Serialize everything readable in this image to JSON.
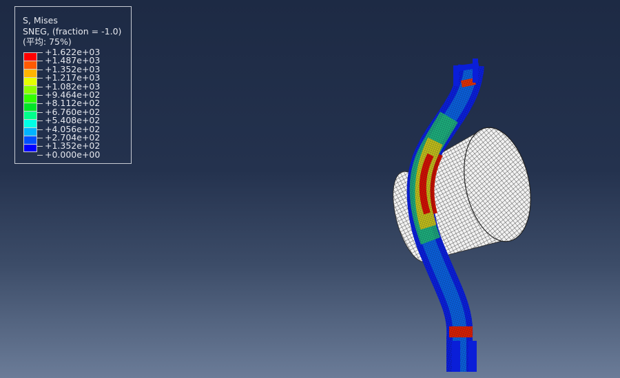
{
  "legend": {
    "title": "S, Mises",
    "subtitle": "SNEG, (fraction = -1.0)",
    "averaging": "(平均: 75%)",
    "labels": [
      "+1.622e+03",
      "+1.487e+03",
      "+1.352e+03",
      "+1.217e+03",
      "+1.082e+03",
      "+9.464e+02",
      "+8.112e+02",
      "+6.760e+02",
      "+5.408e+02",
      "+4.056e+02",
      "+2.704e+02",
      "+1.352e+02",
      "+0.000e+00"
    ],
    "colors": [
      "#ff0000",
      "#ff5a00",
      "#ffb400",
      "#e6ff00",
      "#8cff00",
      "#32ff00",
      "#00e628",
      "#00ff8c",
      "#00ffe6",
      "#00b4ff",
      "#0050ff",
      "#0000ff"
    ]
  }
}
